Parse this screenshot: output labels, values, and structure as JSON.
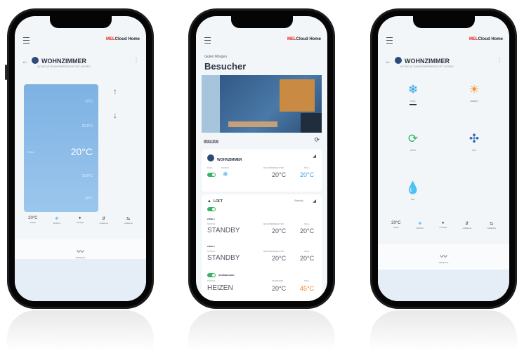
{
  "app": {
    "brand_prefix": "MEL",
    "brand_rest": "Cloud Home",
    "accent_red": "#e2231a"
  },
  "phone1": {
    "room_title": "WOHNZIMMER",
    "room_subtitle": "AKTUELLE RAUMTEMPERATUR 18°C HEIZEN",
    "scale_ticks": [
      "21°C",
      "20,5°C",
      "20°C",
      "19,5°C",
      "19°C"
    ],
    "scale_left_label": "SOLL",
    "setpoint": "20°C",
    "up_arrow": "↑",
    "down_arrow": "↓",
    "modes": [
      {
        "top": "20°C",
        "label": "TEMP"
      },
      {
        "top": "❄",
        "label": "MODUS"
      },
      {
        "top": "♦",
        "label": "LÜFTER"
      },
      {
        "top": "⇵",
        "label": "LAMELLE"
      },
      {
        "top": "⇆",
        "label": "LAMELLE"
      }
    ],
    "stats_label": "VERLAUF"
  },
  "phone2": {
    "greeting": "Guten Morgen",
    "name": "Besucher",
    "filter_label": "MEIN HEIM",
    "card1": {
      "title": "WOHNZIMMER",
      "tag_on": "KÜHL",
      "tag_mode": "MODUS",
      "tag_room": "RAUMTEMPERATUR",
      "tag_set": "SOLL",
      "room_temp": "20°C",
      "set_temp": "20°C"
    },
    "card2": {
      "title": "LOFT",
      "badge": "Standby",
      "zone1": {
        "label": "ZONE 1",
        "state_label": "STATUS",
        "status": "STANDBY",
        "room": "20°C",
        "set": "20°C",
        "tag_room": "RAUMTEMPERATUR",
        "tag_set": "SOLL"
      },
      "zone2": {
        "label": "ZONE 2",
        "state_label": "STATUS",
        "status": "STANDBY",
        "room": "20°C",
        "set": "20°C",
        "tag_room": "RAUMTEMPERATUR",
        "tag_set": "SOLL"
      },
      "water": {
        "label": "WARMWASSER",
        "state_label": "STATUS",
        "status": "HEIZEN",
        "room": "20°C",
        "set": "45°C",
        "tag_room": "TANKTEMP",
        "tag_set": "SOLL"
      }
    }
  },
  "phone3": {
    "room_title": "WOHNZIMMER",
    "room_subtitle": "AKTUELLE RAUMTEMPERATUR 18°C HEIZEN",
    "options": [
      {
        "icon": "❄",
        "label": "KÜHL",
        "color": "#2b9fe8"
      },
      {
        "icon": "☀",
        "label": "HEIZEN",
        "color": "#f3922c"
      },
      {
        "icon": "⟳",
        "label": "AUTO",
        "color": "#34b36a"
      },
      {
        "icon": "✣",
        "label": "FAN",
        "color": "#2f69b3"
      },
      {
        "icon": "💧",
        "label": "DRY",
        "color": "#2b9fe8"
      }
    ],
    "modes": [
      {
        "top": "20°C",
        "label": "TEMP"
      },
      {
        "top": "❄",
        "label": "MODUS"
      },
      {
        "top": "♦",
        "label": "LÜFTER"
      },
      {
        "top": "⇵",
        "label": "LAMELLE"
      },
      {
        "top": "⇆",
        "label": "LAMELLE"
      }
    ],
    "stats_label": "VERLAUF"
  }
}
